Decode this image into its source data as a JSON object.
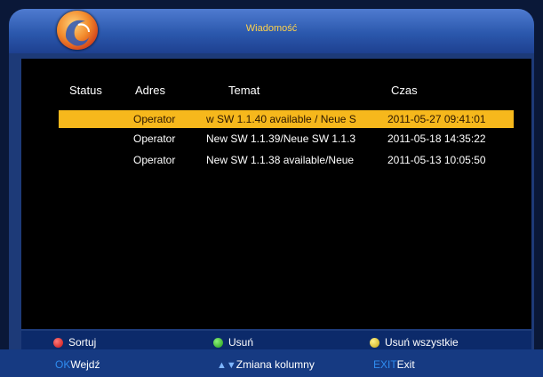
{
  "window": {
    "title": "Wiadomość"
  },
  "columns": [
    "Status",
    "Adres",
    "Temat",
    "Czas"
  ],
  "messages": [
    {
      "status_icon": "envelope-open-icon",
      "address": "Operator",
      "subject": "w SW 1.1.40 available / Neue S",
      "time": "2011-05-27 09:41:01",
      "selected": true
    },
    {
      "status_icon": "envelope-closed-icon",
      "address": "Operator",
      "subject": "New SW 1.1.39/Neue SW 1.1.3",
      "time": "2011-05-18 14:35:22",
      "selected": false
    },
    {
      "status_icon": "envelope-closed-icon",
      "address": "Operator",
      "subject": "New SW 1.1.38 available/Neue",
      "time": "2011-05-13 10:05:50",
      "selected": false
    }
  ],
  "footer": {
    "red_label": "Sortuj",
    "green_label": "Usuń",
    "yellow_label": "Usuń wszystkie"
  },
  "nav": {
    "ok_key": "OK",
    "ok_label": "Wejdź",
    "updown_label": "Zmiana kolumny",
    "exit_key": "EXIT",
    "exit_label": "Exit"
  },
  "colors": {
    "selected_row": "#f6b81c",
    "title_text": "#ffd24a",
    "key_text": "#2f8cf0"
  }
}
